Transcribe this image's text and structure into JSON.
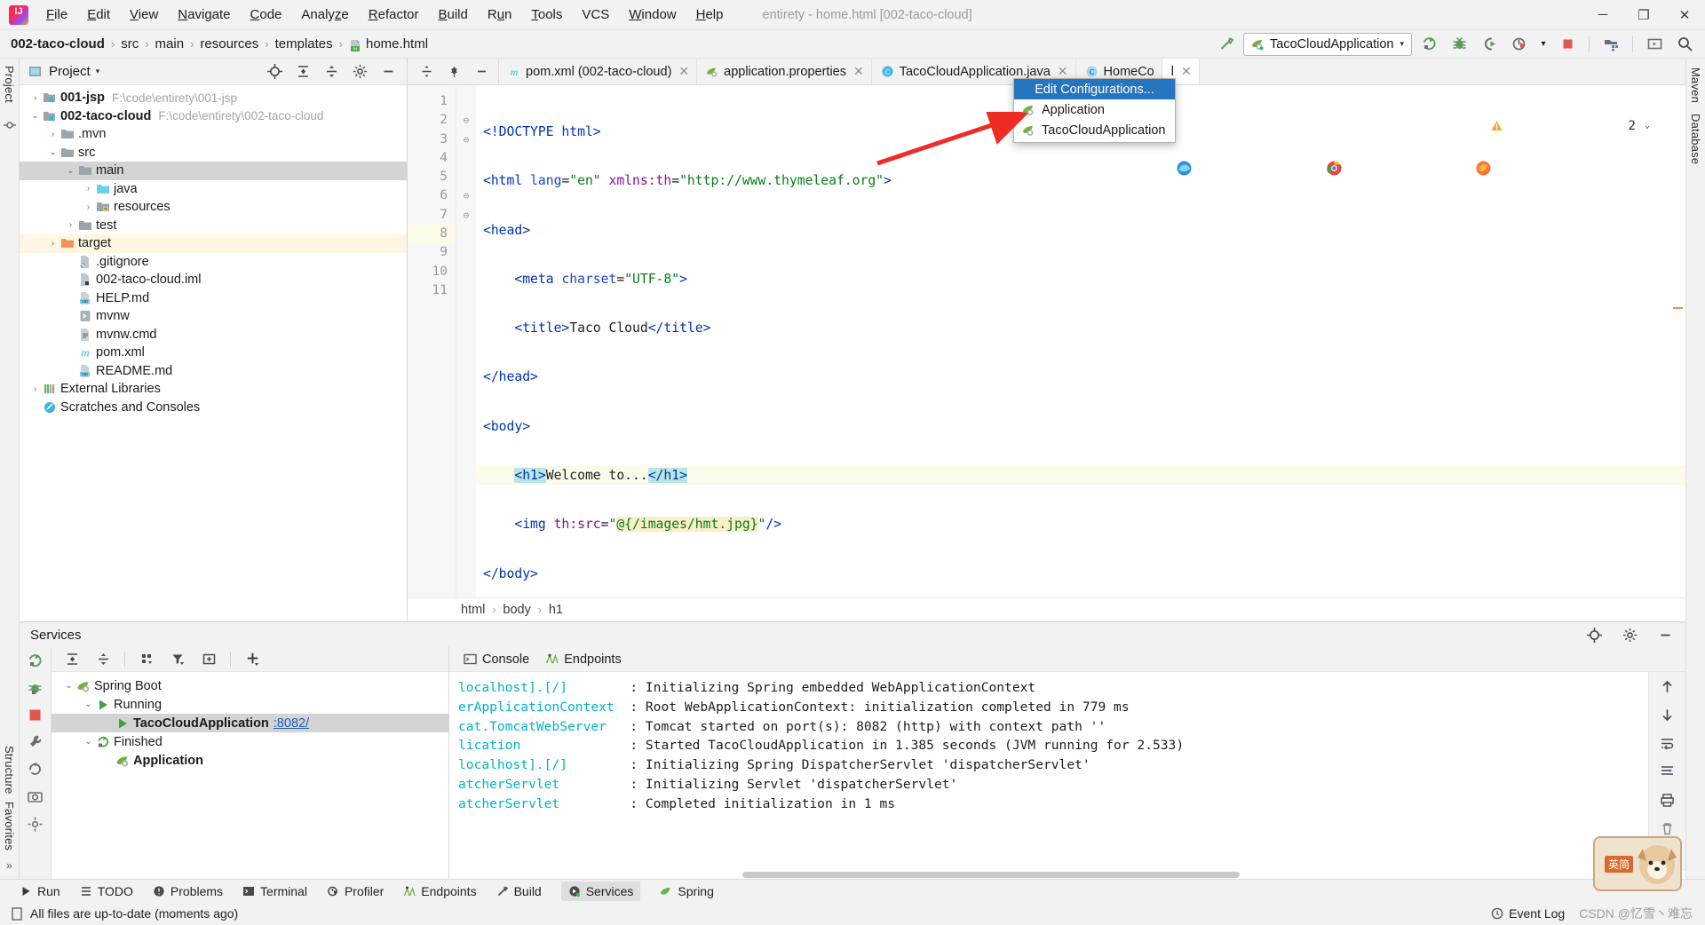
{
  "titlebar": {
    "app_icon": "intellij-logo-icon",
    "menus": [
      "File",
      "Edit",
      "View",
      "Navigate",
      "Code",
      "Analyze",
      "Refactor",
      "Build",
      "Run",
      "Tools",
      "VCS",
      "Window",
      "Help"
    ],
    "window_title": "entirety - home.html [002-taco-cloud]",
    "minimize": "─",
    "maximize": "❐",
    "close": "✕"
  },
  "breadcrumb": {
    "items": [
      "002-taco-cloud",
      "src",
      "main",
      "resources",
      "templates",
      "home.html"
    ],
    "separator": "›"
  },
  "run_toolbar": {
    "build_icon": "hammer-icon",
    "config_name": "TacoCloudApplication",
    "config_caret": "▾",
    "run_icon": "run-icon",
    "debug_icon": "debug-icon",
    "coverage_icon": "run-coverage-icon",
    "profile_icon": "profiler-icon",
    "profile_caret": "▾",
    "stop_icon": "stop-icon",
    "services_icon": "services-icon",
    "layout_icon": "layout-icon",
    "search_icon": "search-icon"
  },
  "run_menu": {
    "selected": "Edit Configurations...",
    "items": [
      {
        "label": "Application",
        "icon": "spring-boot-icon"
      },
      {
        "label": "TacoCloudApplication",
        "icon": "spring-boot-icon"
      }
    ]
  },
  "left_rail": {
    "project_label": "Project",
    "structure_label": "Structure",
    "favorites_label": "Favorites",
    "more": "»"
  },
  "right_rail": {
    "maven_label": "Maven",
    "database_label": "Database"
  },
  "project_panel": {
    "title": "Project",
    "caret": "▾",
    "actions": [
      "locate-icon",
      "expand-all-icon",
      "collapse-all-icon",
      "settings-icon",
      "hide-icon"
    ],
    "tree": [
      {
        "label": "001-jsp",
        "path": "F:\\code\\entirety\\001-jsp",
        "indent": 0,
        "arrow": "›",
        "icon": "module-icon",
        "bold": true,
        "state": "normal"
      },
      {
        "label": "002-taco-cloud",
        "path": "F:\\code\\entirety\\002-taco-cloud",
        "indent": 0,
        "arrow": "⌄",
        "icon": "module-icon",
        "bold": true,
        "state": "normal"
      },
      {
        "label": ".mvn",
        "path": "",
        "indent": 1,
        "arrow": "›",
        "icon": "folder-icon",
        "bold": false,
        "state": "normal"
      },
      {
        "label": "src",
        "path": "",
        "indent": 1,
        "arrow": "⌄",
        "icon": "folder-icon",
        "bold": false,
        "state": "normal"
      },
      {
        "label": "main",
        "path": "",
        "indent": 2,
        "arrow": "⌄",
        "icon": "folder-icon",
        "bold": false,
        "state": "selected"
      },
      {
        "label": "java",
        "path": "",
        "indent": 3,
        "arrow": "›",
        "icon": "source-folder-icon",
        "bold": false,
        "state": "normal"
      },
      {
        "label": "resources",
        "path": "",
        "indent": 3,
        "arrow": "›",
        "icon": "resource-folder-icon",
        "bold": false,
        "state": "normal"
      },
      {
        "label": "test",
        "path": "",
        "indent": 2,
        "arrow": "›",
        "icon": "folder-icon",
        "bold": false,
        "state": "normal"
      },
      {
        "label": "target",
        "path": "",
        "indent": 1,
        "arrow": "›",
        "icon": "excluded-folder-icon",
        "bold": false,
        "state": "amber"
      },
      {
        "label": ".gitignore",
        "path": "",
        "indent": 2,
        "arrow": "",
        "icon": "gitignore-file-icon",
        "bold": false,
        "state": "normal"
      },
      {
        "label": "002-taco-cloud.iml",
        "path": "",
        "indent": 2,
        "arrow": "",
        "icon": "iml-file-icon",
        "bold": false,
        "state": "normal"
      },
      {
        "label": "HELP.md",
        "path": "",
        "indent": 2,
        "arrow": "",
        "icon": "markdown-file-icon",
        "bold": false,
        "state": "normal"
      },
      {
        "label": "mvnw",
        "path": "",
        "indent": 2,
        "arrow": "",
        "icon": "shell-file-icon",
        "bold": false,
        "state": "normal"
      },
      {
        "label": "mvnw.cmd",
        "path": "",
        "indent": 2,
        "arrow": "",
        "icon": "cmd-file-icon",
        "bold": false,
        "state": "normal"
      },
      {
        "label": "pom.xml",
        "path": "",
        "indent": 2,
        "arrow": "",
        "icon": "maven-file-icon",
        "bold": false,
        "state": "normal"
      },
      {
        "label": "README.md",
        "path": "",
        "indent": 2,
        "arrow": "",
        "icon": "markdown-file-icon",
        "bold": false,
        "state": "normal"
      },
      {
        "label": "External Libraries",
        "path": "",
        "indent": 0,
        "arrow": "›",
        "icon": "libraries-icon",
        "bold": false,
        "state": "normal"
      },
      {
        "label": "Scratches and Consoles",
        "path": "",
        "indent": 0,
        "arrow": "",
        "icon": "scratches-icon",
        "bold": false,
        "state": "normal"
      }
    ]
  },
  "editor": {
    "lead_actions": [
      "collapse-icon",
      "pin-icon",
      "hide-icon"
    ],
    "tabs": [
      {
        "label": "pom.xml (002-taco-cloud)",
        "icon": "maven-file-icon",
        "close": "✕",
        "active": false
      },
      {
        "label": "application.properties",
        "icon": "spring-properties-icon",
        "close": "✕",
        "active": false
      },
      {
        "label": "TacoCloudApplication.java",
        "icon": "java-class-icon",
        "close": "✕",
        "active": false
      },
      {
        "label": "HomeCo",
        "icon": "java-class-icon",
        "close": "",
        "active": false
      },
      {
        "label": "l",
        "icon": "",
        "close": "✕",
        "active": true
      }
    ],
    "warning_count": "2",
    "warning_icon": "warning-triangle-icon",
    "inspection_caret": "⌄",
    "browsers": [
      "edge-browser-icon",
      "chrome-browser-icon",
      "firefox-browser-icon"
    ],
    "lines": [
      {
        "n": "1",
        "fold": "",
        "hl": false
      },
      {
        "n": "2",
        "fold": "⊖",
        "hl": false
      },
      {
        "n": "3",
        "fold": "⊖",
        "hl": false
      },
      {
        "n": "4",
        "fold": "",
        "hl": false
      },
      {
        "n": "5",
        "fold": "",
        "hl": false
      },
      {
        "n": "6",
        "fold": "⊖",
        "hl": false
      },
      {
        "n": "7",
        "fold": "⊖",
        "hl": false
      },
      {
        "n": "8",
        "fold": "",
        "hl": true
      },
      {
        "n": "9",
        "fold": "",
        "hl": false
      },
      {
        "n": "10",
        "fold": "",
        "hl": false
      },
      {
        "n": "11",
        "fold": "",
        "hl": false
      }
    ],
    "code_text": [
      "<!DOCTYPE html>",
      "<html lang=\"en\" xmlns:th=\"http://www.thymeleaf.org\">",
      "<head>",
      "    <meta charset=\"UTF-8\">",
      "    <title>Taco Cloud</title>",
      "</head>",
      "<body>",
      "    <h1>Welcome to...</h1>",
      "    <img th:src=\"@{/images/hmt.jpg}\"/>",
      "</body>",
      "</html>"
    ],
    "bottom_breadcrumb": [
      "html",
      "body",
      "h1"
    ],
    "bottom_separator": "›"
  },
  "services": {
    "title": "Services",
    "head_actions": [
      "locate-icon",
      "settings-icon",
      "hide-icon"
    ],
    "rail_icons": [
      "rerun-icon",
      "debug-icon",
      "stop-icon",
      "wrench-icon",
      "restart-icon",
      "camera-icon",
      "settings-icon"
    ],
    "toolbar_icons": [
      "rerun-icon",
      "expand-all-icon",
      "collapse-all-icon",
      "group-icon",
      "filter-icon",
      "add-tab-icon",
      "add-service-icon"
    ],
    "tree": [
      {
        "label": "Spring Boot",
        "indent": 0,
        "arrow": "⌄",
        "icon": "spring-boot-icon",
        "bold": false,
        "port": "",
        "sel": false
      },
      {
        "label": "Running",
        "indent": 1,
        "arrow": "⌄",
        "icon": "run-green-icon",
        "bold": false,
        "port": "",
        "sel": false
      },
      {
        "label": "TacoCloudApplication",
        "indent": 2,
        "arrow": "",
        "icon": "run-green-icon",
        "bold": true,
        "port": ":8082/",
        "sel": true
      },
      {
        "label": "Finished",
        "indent": 1,
        "arrow": "⌄",
        "icon": "rerun-icon",
        "bold": false,
        "port": "",
        "sel": false
      },
      {
        "label": "Application",
        "indent": 2,
        "arrow": "",
        "icon": "spring-boot-icon",
        "bold": true,
        "port": "",
        "sel": false
      }
    ],
    "tabs": [
      {
        "label": "Console",
        "icon": "console-icon",
        "active": true
      },
      {
        "label": "Endpoints",
        "icon": "endpoints-icon",
        "active": false
      }
    ],
    "console_lines": [
      {
        "logger": "localhost].[/]",
        "message": ": Initializing Spring embedded WebApplicationContext"
      },
      {
        "logger": "erApplicationContext",
        "message": ": Root WebApplicationContext: initialization completed in 779 ms"
      },
      {
        "logger": "cat.TomcatWebServer",
        "message": ": Tomcat started on port(s): 8082 (http) with context path ''"
      },
      {
        "logger": "lication",
        "message": ": Started TacoCloudApplication in 1.385 seconds (JVM running for 2.533)"
      },
      {
        "logger": "localhost].[/]",
        "message": ": Initializing Spring DispatcherServlet 'dispatcherServlet'"
      },
      {
        "logger": "atcherServlet",
        "message": ": Initializing Servlet 'dispatcherServlet'"
      },
      {
        "logger": "atcherServlet",
        "message": ": Completed initialization in 1 ms"
      }
    ],
    "console_rail_icons": [
      "scroll-up-icon",
      "scroll-down-icon",
      "soft-wrap-icon",
      "scroll-end-icon",
      "print-icon",
      "trash-icon"
    ]
  },
  "statusbar": {
    "tools": [
      {
        "label": "Run",
        "icon": "run-icon",
        "active": false
      },
      {
        "label": "TODO",
        "icon": "todo-icon",
        "active": false
      },
      {
        "label": "Problems",
        "icon": "problems-icon",
        "active": false
      },
      {
        "label": "Terminal",
        "icon": "terminal-icon",
        "active": false
      },
      {
        "label": "Profiler",
        "icon": "profiler-icon",
        "active": false
      },
      {
        "label": "Endpoints",
        "icon": "endpoints-icon",
        "active": false
      },
      {
        "label": "Build",
        "icon": "build-icon",
        "active": false
      },
      {
        "label": "Services",
        "icon": "services-icon",
        "active": true
      },
      {
        "label": "Spring",
        "icon": "spring-icon",
        "active": false
      }
    ],
    "message": "All files are up-to-date (moments ago)",
    "message_icon": "document-icon",
    "event_log": "Event Log",
    "event_log_icon": "event-log-icon",
    "watermark": "CSDN @忆雪丶难忘"
  },
  "watermark_badge": {
    "text": "英简"
  },
  "colors": {
    "accent_blue": "#2675bf",
    "green": "#4caf50",
    "red_arrow": "#ee2b24",
    "tag_blue": "#0033b3",
    "value_green": "#067d17",
    "ns_purple": "#871094",
    "log_cyan": "#00b3c8"
  }
}
